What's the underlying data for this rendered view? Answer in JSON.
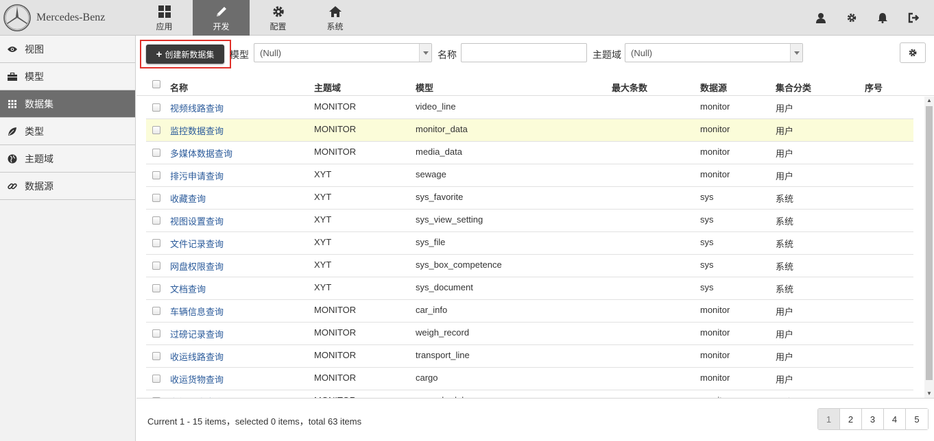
{
  "brand": {
    "name": "Mercedes-Benz"
  },
  "nav": {
    "tabs": [
      {
        "label": "应用",
        "icon": "grid-icon"
      },
      {
        "label": "开发",
        "icon": "pencil-icon"
      },
      {
        "label": "配置",
        "icon": "gear-icon"
      },
      {
        "label": "系统",
        "icon": "home-icon"
      }
    ],
    "active": "开发"
  },
  "topicons": [
    "user-icon",
    "gear-icon",
    "bell-icon",
    "logout-icon"
  ],
  "sidebar": {
    "items": [
      {
        "label": "视图",
        "icon": "eye-icon"
      },
      {
        "label": "模型",
        "icon": "briefcase-icon"
      },
      {
        "label": "数据集",
        "icon": "th-icon"
      },
      {
        "label": "类型",
        "icon": "leaf-icon"
      },
      {
        "label": "主题域",
        "icon": "globe-icon"
      },
      {
        "label": "数据源",
        "icon": "link-icon"
      }
    ],
    "active": "数据集"
  },
  "toolbar": {
    "create_label": "创建新数据集",
    "model_label": "模型",
    "model_value": "(Null)",
    "name_label": "名称",
    "name_value": "",
    "domain_label": "主题域",
    "domain_value": "(Null)"
  },
  "table": {
    "headers": {
      "name": "名称",
      "domain": "主题域",
      "model": "模型",
      "max": "最大条数",
      "source": "数据源",
      "category": "集合分类",
      "order": "序号"
    },
    "rows": [
      {
        "name": "视频线路查询",
        "domain": "MONITOR",
        "model": "video_line",
        "source": "monitor",
        "category": "用户"
      },
      {
        "name": "监控数据查询",
        "domain": "MONITOR",
        "model": "monitor_data",
        "source": "monitor",
        "category": "用户"
      },
      {
        "name": "多媒体数据查询",
        "domain": "MONITOR",
        "model": "media_data",
        "source": "monitor",
        "category": "用户"
      },
      {
        "name": "排污申请查询",
        "domain": "XYT",
        "model": "sewage",
        "source": "monitor",
        "category": "用户"
      },
      {
        "name": "收藏查询",
        "domain": "XYT",
        "model": "sys_favorite",
        "source": "sys",
        "category": "系统"
      },
      {
        "name": "视图设置查询",
        "domain": "XYT",
        "model": "sys_view_setting",
        "source": "sys",
        "category": "系统"
      },
      {
        "name": "文件记录查询",
        "domain": "XYT",
        "model": "sys_file",
        "source": "sys",
        "category": "系统"
      },
      {
        "name": "网盘权限查询",
        "domain": "XYT",
        "model": "sys_box_competence",
        "source": "sys",
        "category": "系统"
      },
      {
        "name": "文档查询",
        "domain": "XYT",
        "model": "sys_document",
        "source": "sys",
        "category": "系统"
      },
      {
        "name": "车辆信息查询",
        "domain": "MONITOR",
        "model": "car_info",
        "source": "monitor",
        "category": "用户"
      },
      {
        "name": "过磅记录查询",
        "domain": "MONITOR",
        "model": "weigh_record",
        "source": "monitor",
        "category": "用户"
      },
      {
        "name": "收运线路查询",
        "domain": "MONITOR",
        "model": "transport_line",
        "source": "monitor",
        "category": "用户"
      },
      {
        "name": "收运货物查询",
        "domain": "MONITOR",
        "model": "cargo",
        "source": "monitor",
        "category": "用户"
      },
      {
        "name": "车辆调度查询",
        "domain": "MONITOR",
        "model": "car_schedule",
        "source": "monitor",
        "category": "用户"
      }
    ],
    "highlighted_row": 1
  },
  "footer": {
    "status": "Current 1 - 15 items，selected 0 items，total 63 items",
    "pages": [
      "1",
      "2",
      "3",
      "4",
      "5"
    ],
    "current_page": "1"
  },
  "colors": {
    "accent_active": "#6d6d6d",
    "highlight_row": "#fbfcd9",
    "create_outline": "#e0302a",
    "link": "#2a5a9a"
  }
}
